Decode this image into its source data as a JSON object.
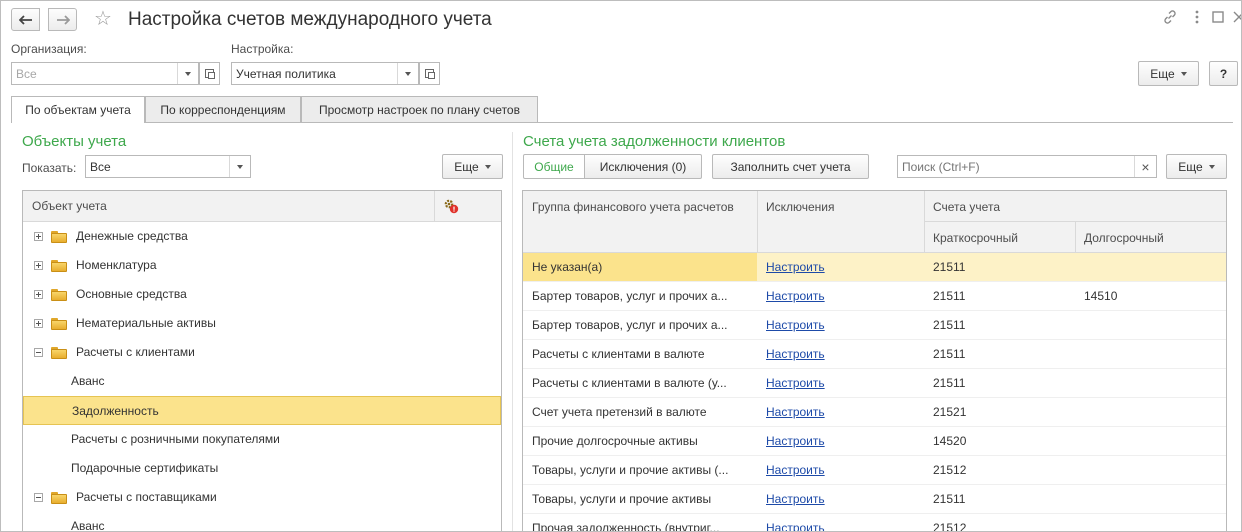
{
  "window": {
    "title": "Настройка счетов международного учета"
  },
  "filters": {
    "organization_label": "Организация:",
    "organization_placeholder": "Все",
    "setting_label": "Настройка:",
    "setting_value": "Учетная политика"
  },
  "toolbar": {
    "more_label": "Еще",
    "help_label": "?"
  },
  "tabs": [
    {
      "label": "По объектам учета",
      "active": true
    },
    {
      "label": "По корреспонденциям",
      "active": false
    },
    {
      "label": "Просмотр настроек по плану счетов",
      "active": false
    }
  ],
  "left": {
    "title": "Объекты учета",
    "show_label": "Показать:",
    "show_value": "Все",
    "more_label": "Еще",
    "column_header": "Объект учета",
    "tree": [
      {
        "label": "Денежные средства",
        "level": 0,
        "folder": true,
        "expander": "plus"
      },
      {
        "label": "Номенклатура",
        "level": 0,
        "folder": true,
        "expander": "plus"
      },
      {
        "label": "Основные средства",
        "level": 0,
        "folder": true,
        "expander": "plus"
      },
      {
        "label": "Нематериальные активы",
        "level": 0,
        "folder": true,
        "expander": "plus"
      },
      {
        "label": "Расчеты с клиентами",
        "level": 0,
        "folder": true,
        "expander": "minus"
      },
      {
        "label": "Аванс",
        "level": 1,
        "folder": false
      },
      {
        "label": "Задолженность",
        "level": 1,
        "folder": false,
        "selected": true
      },
      {
        "label": "Расчеты с розничными покупателями",
        "level": 1,
        "folder": false
      },
      {
        "label": "Подарочные сертификаты",
        "level": 1,
        "folder": false
      },
      {
        "label": "Расчеты с поставщиками",
        "level": 0,
        "folder": true,
        "expander": "minus"
      },
      {
        "label": "Аванс",
        "level": 1,
        "folder": false
      }
    ]
  },
  "right": {
    "title": "Счета учета задолженности клиентов",
    "subtab_general": "Общие",
    "subtab_exceptions": "Исключения (0)",
    "fill_button": "Заполнить счет учета",
    "search_placeholder": "Поиск (Ctrl+F)",
    "clear_label": "×",
    "more_label": "Еще",
    "headers": {
      "group": "Группа финансового учета расчетов",
      "exceptions": "Исключения",
      "accounts": "Счета учета",
      "short_term": "Краткосрочный",
      "long_term": "Долгосрочный"
    },
    "rows": [
      {
        "group": "Не указан(а)",
        "exceptions": "Настроить",
        "short": "21511",
        "long": "",
        "selected": true
      },
      {
        "group": "Бартер товаров, услуг и прочих а...",
        "exceptions": "Настроить",
        "short": "21511",
        "long": "14510"
      },
      {
        "group": "Бартер товаров, услуг и прочих а...",
        "exceptions": "Настроить",
        "short": "21511",
        "long": ""
      },
      {
        "group": "Расчеты с клиентами в валюте",
        "exceptions": "Настроить",
        "short": "21511",
        "long": ""
      },
      {
        "group": "Расчеты с клиентами в валюте (у...",
        "exceptions": "Настроить",
        "short": "21511",
        "long": ""
      },
      {
        "group": "Счет учета претензий в валюте",
        "exceptions": "Настроить",
        "short": "21521",
        "long": ""
      },
      {
        "group": "Прочие долгосрочные активы",
        "exceptions": "Настроить",
        "short": "14520",
        "long": ""
      },
      {
        "group": "Товары, услуги и прочие активы (...",
        "exceptions": "Настроить",
        "short": "21512",
        "long": ""
      },
      {
        "group": "Товары, услуги и прочие активы",
        "exceptions": "Настроить",
        "short": "21511",
        "long": ""
      },
      {
        "group": "Прочая задолженность (внутриг...",
        "exceptions": "Настроить",
        "short": "21512",
        "long": ""
      }
    ]
  },
  "icons": {
    "back": "arrow-left-icon",
    "forward": "arrow-right-icon",
    "favorite": "star-icon",
    "link": "link-icon",
    "menu": "more-vertical-icon",
    "maximize": "maximize-icon",
    "close": "close-icon",
    "settings": "gear-warning-icon"
  },
  "colors": {
    "accent_green": "#3ea84c",
    "selection_yellow": "#fbe38c",
    "link_blue": "#1d4aa8"
  }
}
